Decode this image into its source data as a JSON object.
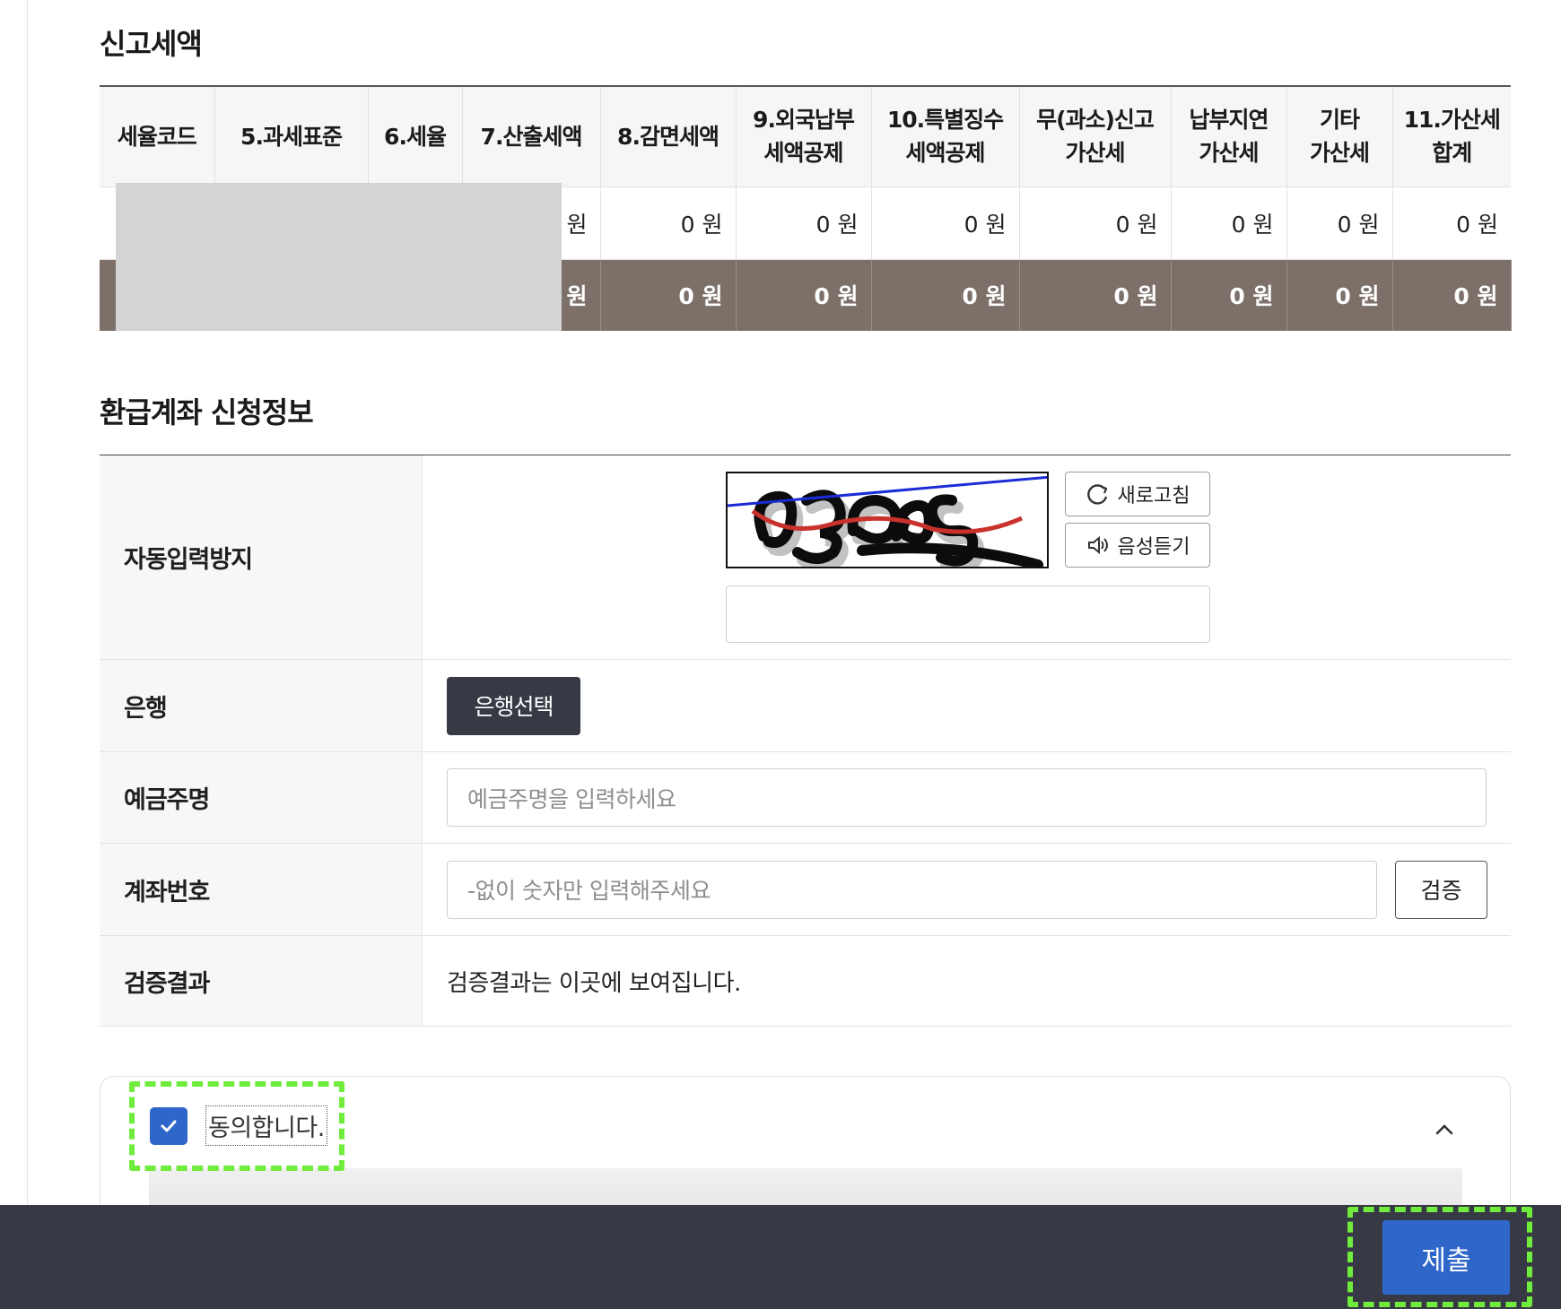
{
  "report_tax": {
    "title": "신고세액",
    "headers": [
      "세율코드",
      "5.과세표준",
      "6.세율",
      "7.산출세액",
      "8.감면세액",
      "9.외국납부\n세액공제",
      "10.특별징수\n세액공제",
      "무(과소)신고\n가산세",
      "납부지연\n가산세",
      "기타\n가산세",
      "11.가산세\n합계"
    ],
    "row": [
      "",
      "",
      "",
      "원",
      "0 원",
      "0 원",
      "0 원",
      "0 원",
      "0 원",
      "0 원",
      "0 원"
    ],
    "total": [
      "",
      "",
      "",
      "원",
      "0 원",
      "0 원",
      "0 원",
      "0 원",
      "0 원",
      "0 원",
      "0 원"
    ]
  },
  "refund": {
    "title": "환급계좌 신청정보",
    "captcha_label": "자동입력방지",
    "refresh_label": "새로고침",
    "audio_label": "음성듣기",
    "captcha_value": "",
    "bank_label": "은행",
    "bank_button": "은행선택",
    "holder_label": "예금주명",
    "holder_placeholder": "예금주명을 입력하세요",
    "account_label": "계좌번호",
    "account_placeholder": "-없이 숫자만 입력해주세요",
    "verify_button": "검증",
    "result_label": "검증결과",
    "result_text": "검증결과는 이곳에 보여집니다."
  },
  "agreement": {
    "label": "동의합니다.",
    "checked": true
  },
  "footer": {
    "submit_label": "제출"
  },
  "colors": {
    "accent": "#2f66c9",
    "dark": "#373a45",
    "total_row": "#7c7069",
    "highlight": "#6fec3c"
  }
}
